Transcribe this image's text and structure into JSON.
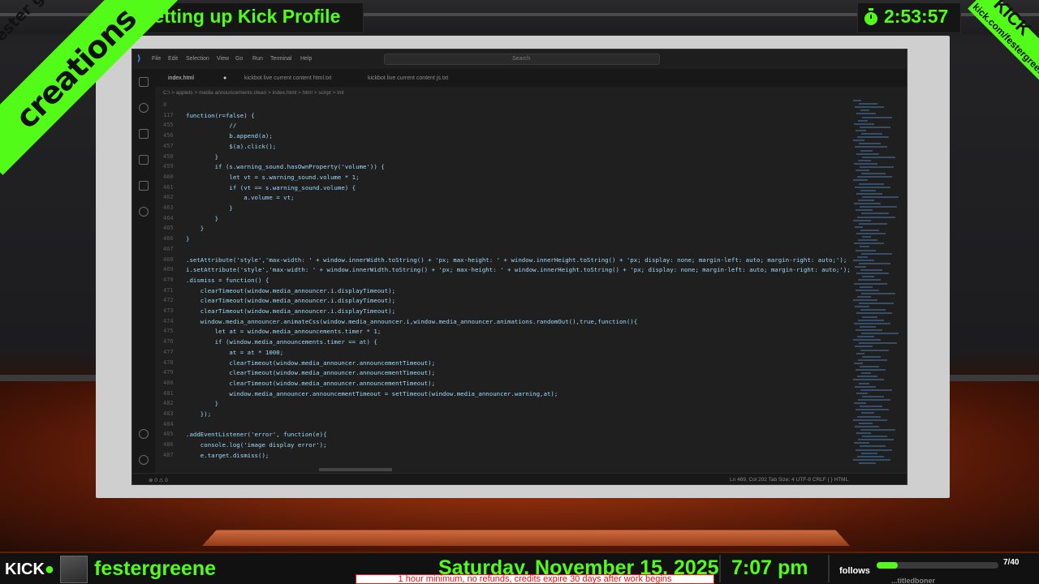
{
  "overlay": {
    "stream_title": "Setting up Kick Profile",
    "timer": "2:53:57",
    "brand_small": "fester greene",
    "brand_big": "creations",
    "kick_logo_corner": "KICK",
    "kick_url": "kick.com/festergreene",
    "kick_logo_bottom": "KICK",
    "channel_name": "festergreene",
    "date": "Saturday, November 15, 2025",
    "time": "7:07 pm",
    "follows_label": "follows",
    "follows_count": "7/40",
    "follows_progress": 0.175,
    "follower_name": "...titledboner",
    "disclaimer": "1 hour minimum, no refunds, credits expire 30 days after work begins",
    "accent_color": "#53fc18"
  },
  "vscode": {
    "menu": [
      "File",
      "Edit",
      "Selection",
      "View",
      "Go",
      "Run",
      "Terminal",
      "Help"
    ],
    "search_placeholder": "Search",
    "tabs": [
      "index.html",
      "kickbot live current content html.txt",
      "kickbot live current content js.txt"
    ],
    "breadcrumb": "C:\\ > applets > media announcements clean > index.html > html > script > init",
    "code_lines": [
      {
        "ln": "8",
        "text": ""
      },
      {
        "ln": "117",
        "text": "function(r=false) {"
      },
      {
        "ln": "455",
        "text": "            //"
      },
      {
        "ln": "456",
        "text": "            b.append(a);"
      },
      {
        "ln": "457",
        "text": "            $(a).click();"
      },
      {
        "ln": "458",
        "text": "        }"
      },
      {
        "ln": "459",
        "text": "        if (s.warning_sound.hasOwnProperty('volume')) {"
      },
      {
        "ln": "460",
        "text": "            let vt = s.warning_sound.volume * 1;"
      },
      {
        "ln": "461",
        "text": "            if (vt == s.warning_sound.volume) {"
      },
      {
        "ln": "462",
        "text": "                a.volume = vt;"
      },
      {
        "ln": "463",
        "text": "            }"
      },
      {
        "ln": "464",
        "text": "        }"
      },
      {
        "ln": "465",
        "text": "    }"
      },
      {
        "ln": "466",
        "text": "}"
      },
      {
        "ln": "467",
        "text": ""
      },
      {
        "ln": "468",
        "text": ".setAttribute('style','max-width: ' + window.innerWidth.toString() + 'px; max-height: ' + window.innerHeight.toString() + 'px; display: none; margin-left: auto; margin-right: auto;');"
      },
      {
        "ln": "469",
        "text": "i.setAttribute('style','max-width: ' + window.innerWidth.toString() + 'px; max-height: ' + window.innerHeight.toString() + 'px; display: none; margin-left: auto; margin-right: auto;');"
      },
      {
        "ln": "470",
        "text": ".dismiss = function() {"
      },
      {
        "ln": "471",
        "text": "    clearTimeout(window.media_announcer.i.displayTimeout);"
      },
      {
        "ln": "472",
        "text": "    clearTimeout(window.media_announcer.i.displayTimeout);"
      },
      {
        "ln": "473",
        "text": "    clearTimeout(window.media_announcer.i.displayTimeout);"
      },
      {
        "ln": "474",
        "text": "    window.media_announcer.animateCss(window.media_announcer.i,window.media_announcer.animations.randomOut(),true,function(){"
      },
      {
        "ln": "475",
        "text": "        let at = window.media_announcements.timer * 1;"
      },
      {
        "ln": "476",
        "text": "        if (window.media_announcements.timer == at) {"
      },
      {
        "ln": "477",
        "text": "            at = at * 1000;"
      },
      {
        "ln": "478",
        "text": "            clearTimeout(window.media_announcer.announcementTimeout);"
      },
      {
        "ln": "479",
        "text": "            clearTimeout(window.media_announcer.announcementTimeout);"
      },
      {
        "ln": "480",
        "text": "            clearTimeout(window.media_announcer.announcementTimeout);"
      },
      {
        "ln": "481",
        "text": "            window.media_announcer.announcementTimeout = setTimeout(window.media_announcer.warning,at);"
      },
      {
        "ln": "482",
        "text": "        }"
      },
      {
        "ln": "483",
        "text": "    });"
      },
      {
        "ln": "484",
        "text": ""
      },
      {
        "ln": "485",
        "text": ".addEventListener('error', function(e){"
      },
      {
        "ln": "486",
        "text": "    console.log('image display error');"
      },
      {
        "ln": "487",
        "text": "    e.target.dismiss();"
      }
    ],
    "status_left": "⊗ 0 ⚠ 0",
    "status_right": "Ln 469, Col 202   Tab Size: 4   UTF-8   CRLF   { } HTML"
  }
}
